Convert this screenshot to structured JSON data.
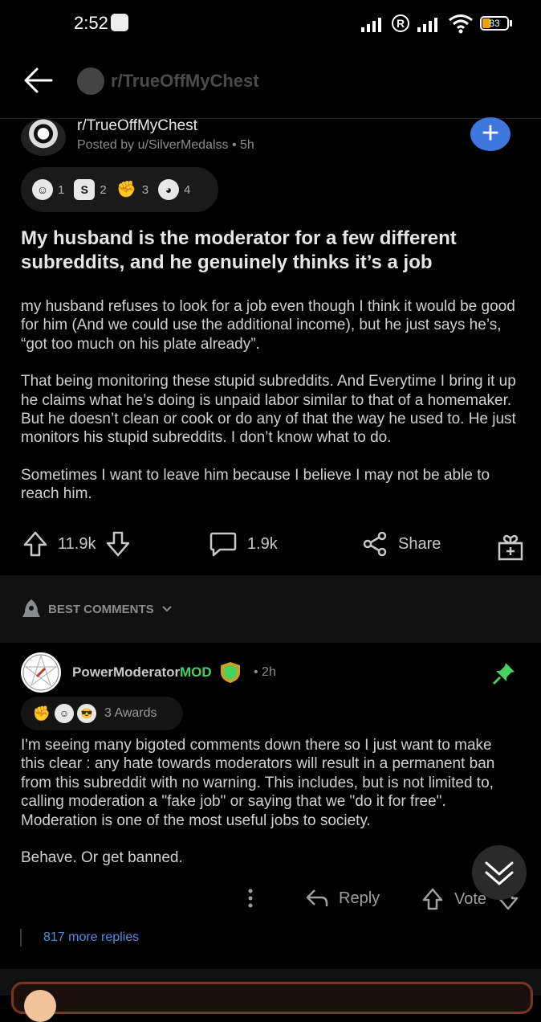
{
  "status_bar": {
    "time": "2:52",
    "battery": "83"
  },
  "nav": {
    "subreddit": "r/TrueOffMyChest"
  },
  "post": {
    "subreddit": "r/TrueOffMyChest",
    "meta": "Posted by u/SilverMedalss • 5h",
    "join_label": "+",
    "awards": [
      {
        "icon": "snoo-award-icon",
        "count": "1"
      },
      {
        "icon": "silver-award-icon",
        "count": "2"
      },
      {
        "icon": "wholesome-award-icon",
        "count": "3"
      },
      {
        "icon": "helpful-award-icon",
        "count": "4"
      }
    ],
    "title": "My husband is the moderator for a few different subreddits, and he genuinely thinks it’s a job",
    "paragraphs": [
      "my husband refuses to look for a job even though I think it would be good for him (And we could use the additional income), but he just says he’s, “got too much on his plate already”.",
      "That being monitoring these stupid subreddits. And Everytime I bring it up he claims what he’s doing is unpaid labor similar to that of a homemaker. But he doesn’t clean or cook or do any of that the way he used to. He just monitors his stupid subreddits. I don’t know what to do.",
      "Sometimes I want to leave him because I believe I may not be able to reach him."
    ],
    "upvotes": "11.9k",
    "comments": "1.9k",
    "share_label": "Share"
  },
  "sort": {
    "label": "BEST COMMENTS"
  },
  "comment": {
    "user": "PowerModerator",
    "mod_badge": "MOD",
    "time": "• 2h",
    "awards_text": "3 Awards",
    "paragraphs": [
      "I'm seeing many bigoted comments down there so I just want to make this clear : any hate towards moderators will result in a permanent ban from this subreddit with no warning. This includes, but is not limited to, calling moderation a \"fake job\" or saying that we \"do it for free\". Moderation is one of the most useful jobs to society.",
      "Behave. Or get banned."
    ],
    "reply_label": "Reply",
    "vote_label": "Vote",
    "more_replies": "817 more replies"
  },
  "colors": {
    "accent": "#3e78de",
    "mod": "#46d160",
    "link": "#4f8fe0",
    "bg": "#000000"
  }
}
